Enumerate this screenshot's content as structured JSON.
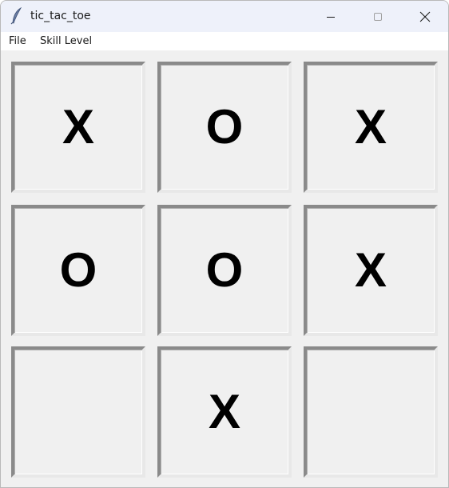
{
  "window": {
    "title": "tic_tac_toe",
    "app_icon": "feather-icon",
    "controls": [
      "minimize-icon",
      "maximize-icon",
      "close-icon"
    ]
  },
  "menu": {
    "file_label": "File",
    "skill_label": "Skill Level"
  },
  "board": {
    "cells": [
      "X",
      "O",
      "X",
      "O",
      "O",
      "X",
      "",
      "X",
      ""
    ]
  },
  "colors": {
    "titlebar": "#eef1fa",
    "board_background": "#f0f0f0",
    "mark": "#000000"
  }
}
